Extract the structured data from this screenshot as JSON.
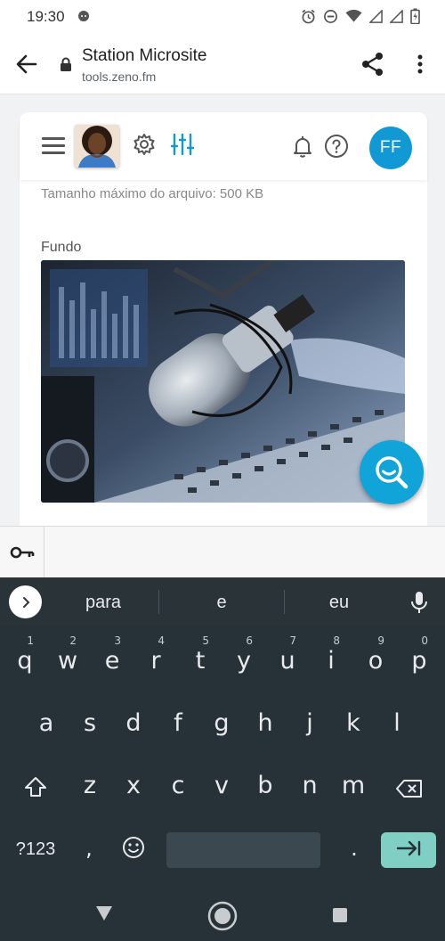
{
  "status_bar": {
    "time": "19:30",
    "icons": [
      "notification-icon",
      "alarm-icon",
      "do-not-disturb-icon",
      "wifi-icon",
      "signal-icon",
      "signal-icon",
      "battery-icon"
    ]
  },
  "browser": {
    "title": "Station Microsite",
    "url": "tools.zeno.fm"
  },
  "app_header": {
    "user_initials": "FF",
    "accent_color": "#1199d6"
  },
  "content": {
    "file_size_note": "Tamanho máximo do arquivo: 500 KB",
    "background_label": "Fundo"
  },
  "keyboard": {
    "suggestions": [
      "para",
      "e",
      "eu"
    ],
    "row1": [
      {
        "key": "q",
        "num": "1"
      },
      {
        "key": "w",
        "num": "2"
      },
      {
        "key": "e",
        "num": "3"
      },
      {
        "key": "r",
        "num": "4"
      },
      {
        "key": "t",
        "num": "5"
      },
      {
        "key": "y",
        "num": "6"
      },
      {
        "key": "u",
        "num": "7"
      },
      {
        "key": "i",
        "num": "8"
      },
      {
        "key": "o",
        "num": "9"
      },
      {
        "key": "p",
        "num": "0"
      }
    ],
    "row2": [
      "a",
      "s",
      "d",
      "f",
      "g",
      "h",
      "j",
      "k",
      "l"
    ],
    "row3": [
      "z",
      "x",
      "c",
      "v",
      "b",
      "n",
      "m"
    ],
    "symbols_key": "?123",
    "comma_key": ",",
    "period_key": "."
  }
}
